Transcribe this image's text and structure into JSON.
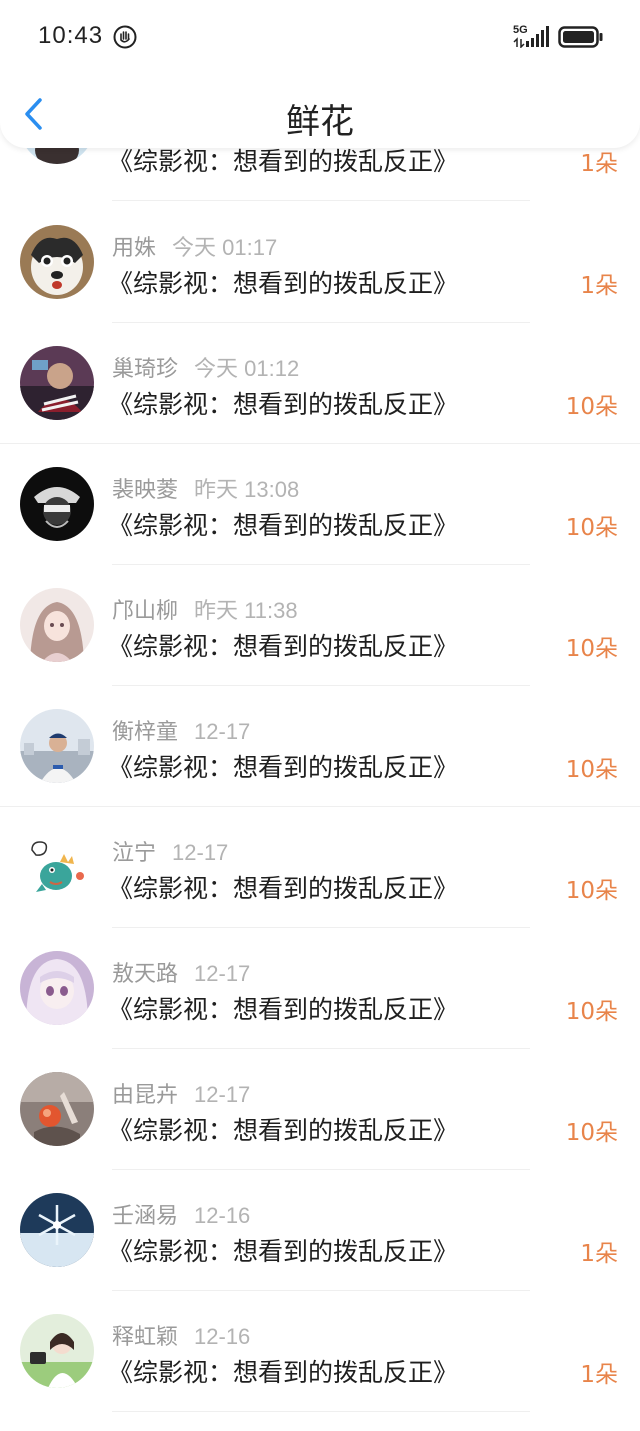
{
  "status_bar": {
    "time": "10:43",
    "network": "5G",
    "icons": [
      "hand-icon",
      "signal-icon",
      "battery-icon"
    ]
  },
  "nav": {
    "title": "鲜花",
    "back_icon": "chevron-left-icon",
    "accent": "#2a8ef0"
  },
  "colors": {
    "count": "#e8844a",
    "name": "#9a9a9a"
  },
  "partial_row": {
    "book": "《综影视：想看到的拨乱反正》",
    "count": "1朵"
  },
  "rows": [
    {
      "name": "用姝",
      "time": "今天 01:17",
      "book": "《综影视：想看到的拨乱反正》",
      "count": "1朵"
    },
    {
      "name": "巢琦珍",
      "time": "今天 01:12",
      "book": "《综影视：想看到的拨乱反正》",
      "count": "10朵"
    },
    {
      "name": "裴映菱",
      "time": "昨天 13:08",
      "book": "《综影视：想看到的拨乱反正》",
      "count": "10朵"
    },
    {
      "name": "邝山柳",
      "time": "昨天 11:38",
      "book": "《综影视：想看到的拨乱反正》",
      "count": "10朵"
    },
    {
      "name": "衡梓童",
      "time": "12-17",
      "book": "《综影视：想看到的拨乱反正》",
      "count": "10朵"
    },
    {
      "name": "泣宁",
      "time": "12-17",
      "book": "《综影视：想看到的拨乱反正》",
      "count": "10朵"
    },
    {
      "name": "敖天路",
      "time": "12-17",
      "book": "《综影视：想看到的拨乱反正》",
      "count": "10朵"
    },
    {
      "name": "由昆卉",
      "time": "12-17",
      "book": "《综影视：想看到的拨乱反正》",
      "count": "10朵"
    },
    {
      "name": "壬涵易",
      "time": "12-16",
      "book": "《综影视：想看到的拨乱反正》",
      "count": "1朵"
    },
    {
      "name": "释虹颖",
      "time": "12-16",
      "book": "《综影视：想看到的拨乱反正》",
      "count": "1朵"
    }
  ]
}
